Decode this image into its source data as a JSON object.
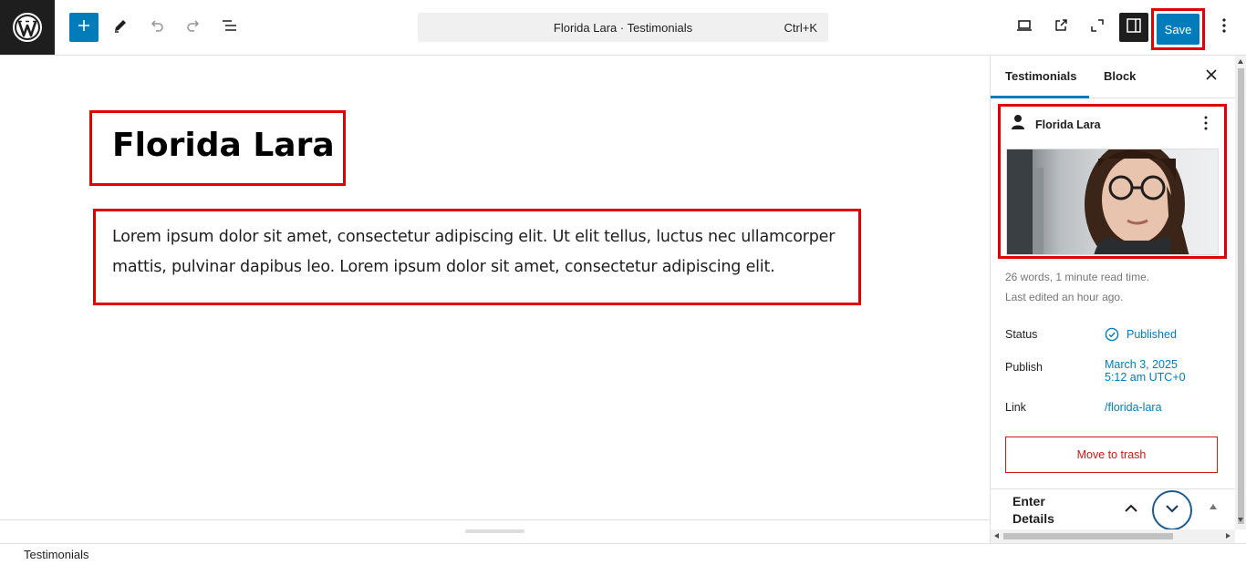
{
  "topbar": {
    "command_title": "Florida Lara · Testimonials",
    "command_shortcut": "Ctrl+K",
    "save_label": "Save"
  },
  "icons": {
    "logo": "wordpress-logo-icon",
    "add": "plus-icon",
    "tools": "pencil-icon",
    "undo": "undo-icon",
    "redo": "redo-icon",
    "outline": "list-view-icon",
    "view": "laptop-icon",
    "preview": "external-link-icon",
    "fullscreen": "fullscreen-icon",
    "settings": "sidebar-toggle-icon",
    "options": "vertical-ellipsis-icon"
  },
  "editor": {
    "title": "Florida Lara",
    "paragraph": "Lorem ipsum dolor sit amet, consectetur adipiscing elit. Ut elit tellus, luctus nec ullamcorper mattis, pulvinar dapibus leo. Lorem ipsum dolor sit amet, consectetur adipiscing elit."
  },
  "footer": {
    "breadcrumb": "Testimonials"
  },
  "sidebar": {
    "tabs": [
      {
        "label": "Testimonials",
        "active": true
      },
      {
        "label": "Block",
        "active": false
      }
    ],
    "post_card": {
      "name": "Florida Lara"
    },
    "meta": {
      "words": "26 words, 1 minute read time.",
      "edited": "Last edited an hour ago."
    },
    "status": {
      "label": "Status",
      "value": "Published"
    },
    "publish": {
      "label": "Publish",
      "date": "March 3, 2025",
      "time": "5:12 am UTC+0"
    },
    "link": {
      "label": "Link",
      "value": "/florida-lara"
    },
    "trash_label": "Move to trash",
    "details_title": "Enter Details"
  },
  "colors": {
    "accent": "#007cba",
    "highlight": "#e00000",
    "danger": "#cc1818"
  }
}
